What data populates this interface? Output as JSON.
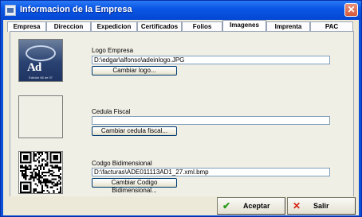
{
  "window": {
    "title": "Informacion de la Empresa",
    "close_glyph": "✕"
  },
  "tabs": [
    {
      "label": "Empresa"
    },
    {
      "label": "Direccion"
    },
    {
      "label": "Expedicion"
    },
    {
      "label": "Certificados"
    },
    {
      "label": "Folios"
    },
    {
      "label": "Imagenes",
      "active": true
    },
    {
      "label": "Imprenta"
    },
    {
      "label": "PAC"
    }
  ],
  "logo": {
    "label": "Logo Empresa",
    "path": "D:\\edgar\\alfonso\\adeinlogo.JPG",
    "button": "Cambiar logo...",
    "image_mark": "Ad",
    "image_tag": "Edición 68 de 07"
  },
  "cedula": {
    "label": "Cedula Fiscal",
    "path": "",
    "button": "Cambiar cedula fiscal..."
  },
  "codigo": {
    "label": "Codgo Bidimensional",
    "path": "D:\\facturas\\ADE011113AD1_27.xml.bmp",
    "button": "Cambiar Codigo Bidimensional..."
  },
  "footer": {
    "accept_label": "Aceptar",
    "exit_label": "Salir",
    "accept_icon": "check-icon",
    "exit_icon": "x-icon"
  },
  "colors": {
    "titlebar": "#0a56e4",
    "window_bg": "#ece9d8",
    "accept_check": "#2a9a18",
    "exit_x": "#d82010"
  }
}
